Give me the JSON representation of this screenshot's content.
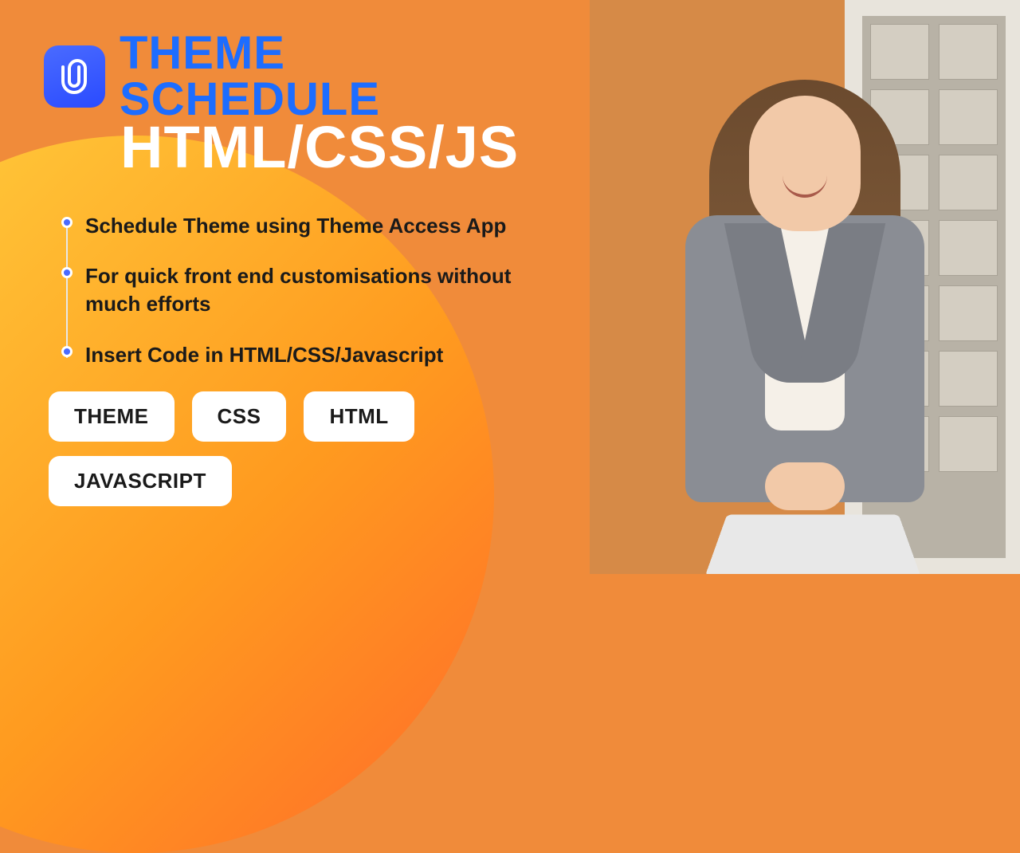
{
  "header": {
    "title_line1": "THEME SCHEDULE",
    "title_line2": "HTML/CSS/JS",
    "icon_name": "attachment-icon"
  },
  "bullets": [
    "Schedule Theme using Theme Access App",
    "For quick front end customisations without much efforts",
    "Insert Code in HTML/CSS/Javascript"
  ],
  "tags": [
    "THEME",
    "CSS",
    "HTML",
    "JAVASCRIPT"
  ]
}
